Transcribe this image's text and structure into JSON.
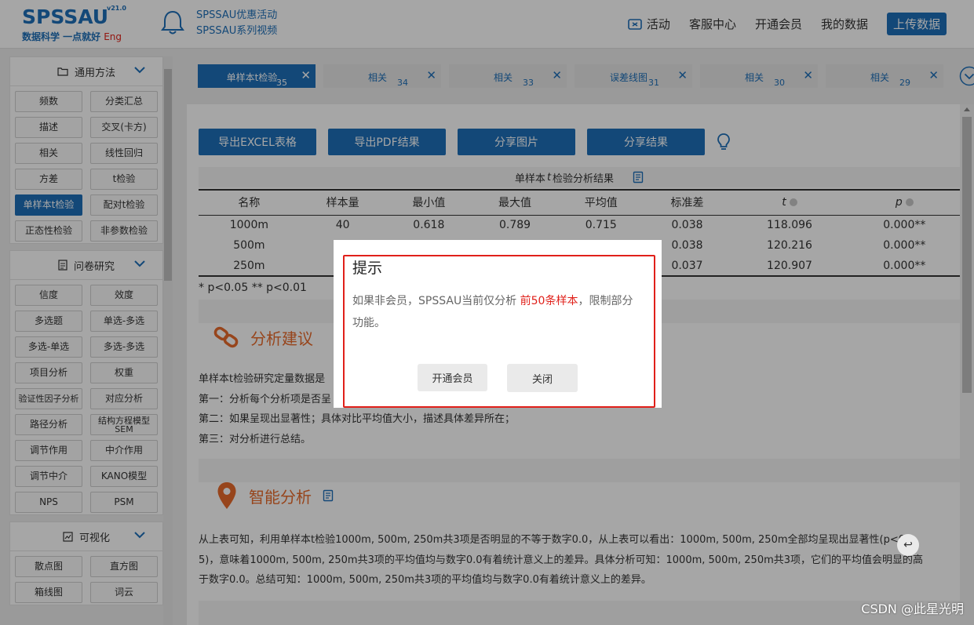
{
  "header": {
    "logo": "SPSSAU",
    "version": "v21.0",
    "slogan": "数据科学 一点就好",
    "lang": "Eng",
    "promo": [
      "SPSSAU优惠活动",
      "SPSSAU系列视频"
    ],
    "nav": [
      "活动",
      "客服中心",
      "开通会员",
      "我的数据"
    ],
    "upload": "上传数据"
  },
  "sidebar": {
    "sections": [
      {
        "title": "通用方法",
        "icon": "folder-icon",
        "items": [
          "频数",
          "分类汇总",
          "描述",
          "交叉(卡方)",
          "相关",
          "线性回归",
          "方差",
          "t检验",
          "单样本t检验",
          "配对t检验",
          "正态性检验",
          "非参数检验"
        ],
        "active": "单样本t检验"
      },
      {
        "title": "问卷研究",
        "icon": "document-icon",
        "items": [
          "信度",
          "效度",
          "多选题",
          "单选-多选",
          "多选-单选",
          "多选-多选",
          "项目分析",
          "权重",
          "验证性因子分析",
          "对应分析",
          "路径分析",
          "结构方程模型SEM",
          "调节作用",
          "中介作用",
          "调节中介",
          "KANO模型",
          "NPS",
          "PSM"
        ]
      },
      {
        "title": "可视化",
        "icon": "chart-icon",
        "items": [
          "散点图",
          "直方图",
          "箱线图",
          "词云"
        ]
      }
    ]
  },
  "tabs": [
    {
      "label": "单样本t检验",
      "count": "35",
      "active": true
    },
    {
      "label": "相关",
      "count": "34"
    },
    {
      "label": "相关",
      "count": "33"
    },
    {
      "label": "误差线图",
      "count": "31"
    },
    {
      "label": "相关",
      "count": "30"
    },
    {
      "label": "相关",
      "count": "29"
    }
  ],
  "actions": [
    "导出EXCEL表格",
    "导出PDF结果",
    "分享图片",
    "分享结果"
  ],
  "result": {
    "title_pre": "单样本",
    "title_t": "t",
    "title_post": "检验分析结果",
    "headers": [
      "名称",
      "样本量",
      "最小值",
      "最大值",
      "平均值",
      "标准差",
      "t",
      "p"
    ],
    "rows": [
      [
        "1000m",
        "40",
        "0.618",
        "0.789",
        "0.715",
        "0.038",
        "118.096",
        "0.000**"
      ],
      [
        "500m",
        "",
        "",
        "",
        "",
        "0.038",
        "120.216",
        "0.000**"
      ],
      [
        "250m",
        "",
        "",
        "",
        "",
        "0.037",
        "120.907",
        "0.000**"
      ]
    ],
    "note": "* p<0.05 ** p<0.01"
  },
  "advice": {
    "title": "分析建议",
    "lines": [
      "单样本t检验研究定量数据是",
      "第一：分析每个分析项是否呈",
      "第二：如果呈现出显著性；具体对比平均值大小，描述具体差异所在；",
      "第三：对分析进行总结。"
    ]
  },
  "smart": {
    "title": "智能分析",
    "lines": [
      "从上表可知，利用单样本t检验1000m, 500m, 250m共3项是否明显的不等于数字0.0，从上表可以看出：1000m, 500m, 250m全部均呈现出显著性(p<0.0",
      "5)，意味着1000m, 500m, 250m共3项的平均值均与数字0.0有着统计意义上的差异。具体分析可知：1000m, 500m, 250m共3项，它们的平均值会明显的高",
      "于数字0.0。总结可知：1000m, 500m, 250m共3项的平均值均与数字0.0有着统计意义上的差异。"
    ]
  },
  "modal": {
    "title": "提示",
    "msg_pre": "如果非会员，SPSSAU当前仅分析 ",
    "msg_hl": "前50条样本",
    "msg_post": "，限制部分功能。",
    "btn_primary": "开通会员",
    "btn_close": "关闭"
  },
  "watermark": "CSDN @此星光明"
}
